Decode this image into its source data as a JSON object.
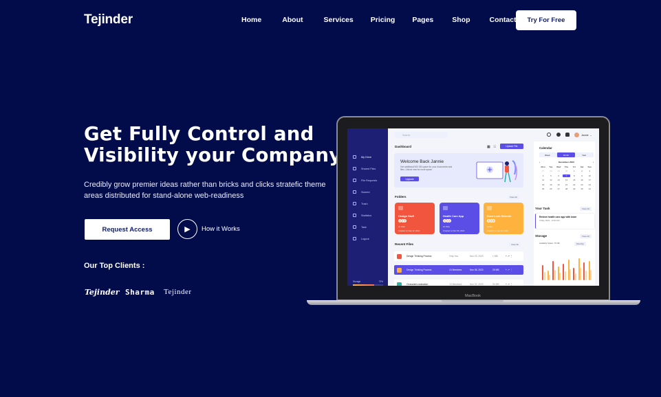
{
  "brand": "Tejinder",
  "nav": {
    "items": [
      "Home",
      "About",
      "Services",
      "Pricing",
      "Pages",
      "Shop",
      "Contact"
    ],
    "cta": "Try For Free"
  },
  "hero": {
    "title_line1": "Get Fully Control and",
    "title_line2": "Visibility your Company",
    "subtitle_line1": "Credibly grow premier ideas rather than bricks and clicks stratefic theme",
    "subtitle_line2": "areas distributed for stand-alone web-readiness",
    "primary_button": "Request Access",
    "secondary_button": "How it Works"
  },
  "clients": {
    "heading": "Our Top Clients :",
    "logos": [
      "Tejinder",
      "Sharma",
      "Tejinder"
    ]
  },
  "laptop": {
    "label": "MacBook",
    "dashboard": {
      "sidebar": {
        "items": [
          "My Drive",
          "Shared Files",
          "File Requests",
          "Starred",
          "Trash",
          "Statistics",
          "Task",
          "Logout"
        ],
        "storage_label": "Storage",
        "storage_percent": "73%"
      },
      "search_placeholder": "Search",
      "user_name": "Jannie",
      "title": "Dashboard",
      "upload_button": "Upload File",
      "welcome": {
        "heading": "Welcome Back Jannie",
        "text": "Get additional 500 GB space for your documents and files. Unlock now for more space",
        "button": "Upgrade"
      },
      "folders_title": "Folders",
      "view_all": "View All",
      "folders": [
        {
          "name": "Design Stuff",
          "files": "24 Files",
          "date": "Created on Sep 12, 2022",
          "color": "#f2553e"
        },
        {
          "name": "Health Care App",
          "files": "12 Files",
          "date": "Created on Nov 06, 2022",
          "color": "#5b4ee6"
        },
        {
          "name": "Sass Look Website",
          "files": "9 Files",
          "date": "Created on Jan 01, 2023",
          "color": "#ffb23e"
        }
      ],
      "recent_title": "Recent Files",
      "recent": [
        {
          "name": "Design Thinking Process",
          "members": "Only You",
          "date": "Nov 23, 2023",
          "size": "1 MB"
        },
        {
          "name": "Design Thinking Process",
          "members": "10 Members",
          "date": "Nov 08, 2023",
          "size": "25 MB"
        },
        {
          "name": "Characters animation",
          "members": "10 Members",
          "date": "Nov 02, 2023",
          "size": "90 MB"
        }
      ],
      "calendar": {
        "title": "Calendar",
        "tabs": [
          "Week",
          "Month",
          "Year"
        ],
        "month": "December 2023",
        "weekdays": [
          "Mon",
          "Tue",
          "Wed",
          "Thu",
          "Fri",
          "Sat",
          "Sun"
        ],
        "days": [
          "27",
          "28",
          "29",
          "30",
          "1",
          "2",
          "3",
          "4",
          "5",
          "6",
          "7",
          "8",
          "9",
          "10",
          "11",
          "12",
          "13",
          "14",
          "15",
          "16",
          "17",
          "18",
          "19",
          "20",
          "21",
          "22",
          "23",
          "24",
          "25",
          "26",
          "27",
          "28",
          "29",
          "30",
          "31"
        ],
        "today": "7"
      },
      "task": {
        "title": "Your Task",
        "name": "Review health care app with team",
        "meta": "3 May, 2024 · 10:00 AM"
      },
      "storage": {
        "title": "Storage",
        "subtitle": "Available Space: 70 GB",
        "period": "Monthly",
        "bars": [
          0.55,
          0.35,
          0.7,
          0.5,
          0.6,
          0.75,
          0.45,
          0.8,
          0.65,
          0.7
        ]
      }
    }
  }
}
